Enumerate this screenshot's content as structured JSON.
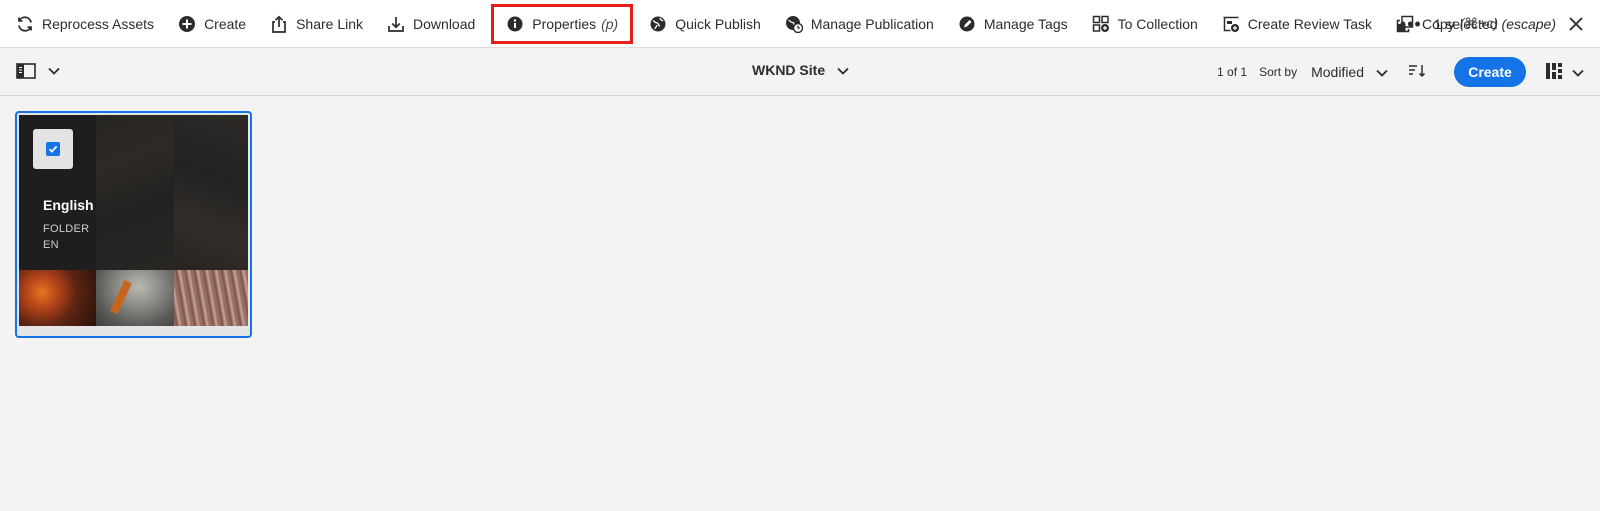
{
  "actionbar": {
    "actions": [
      {
        "label": "Reprocess Assets",
        "icon": "refresh-icon"
      },
      {
        "label": "Create",
        "icon": "add-circle-icon"
      },
      {
        "label": "Share Link",
        "icon": "share-icon"
      },
      {
        "label": "Download",
        "icon": "download-icon"
      },
      {
        "label": "Properties",
        "shortcut": "(p)",
        "icon": "info-icon",
        "highlighted": true
      },
      {
        "label": "Quick Publish",
        "icon": "globe-icon"
      },
      {
        "label": "Manage Publication",
        "icon": "globe-clock-icon"
      },
      {
        "label": "Manage Tags",
        "icon": "tag-icon"
      },
      {
        "label": "To Collection",
        "icon": "collection-add-icon"
      },
      {
        "label": "Create Review Task",
        "icon": "task-add-icon"
      },
      {
        "label": "Copy",
        "shortcut": "(⌘+c)",
        "icon": "copy-icon"
      }
    ],
    "more_label": "•••",
    "selected_label": "1 selected",
    "escape_label": "(escape)"
  },
  "toolbar": {
    "breadcrumb_title": "WKND Site",
    "paging": "1 of 1",
    "sort_by_label": "Sort by",
    "sort_value": "Modified",
    "create_label": "Create"
  },
  "card": {
    "title": "English",
    "type": "FOLDER",
    "language": "EN",
    "selected": true
  },
  "colors": {
    "accent": "#1473e6",
    "highlight": "#e61e1e",
    "background": "#f3f3f3"
  }
}
